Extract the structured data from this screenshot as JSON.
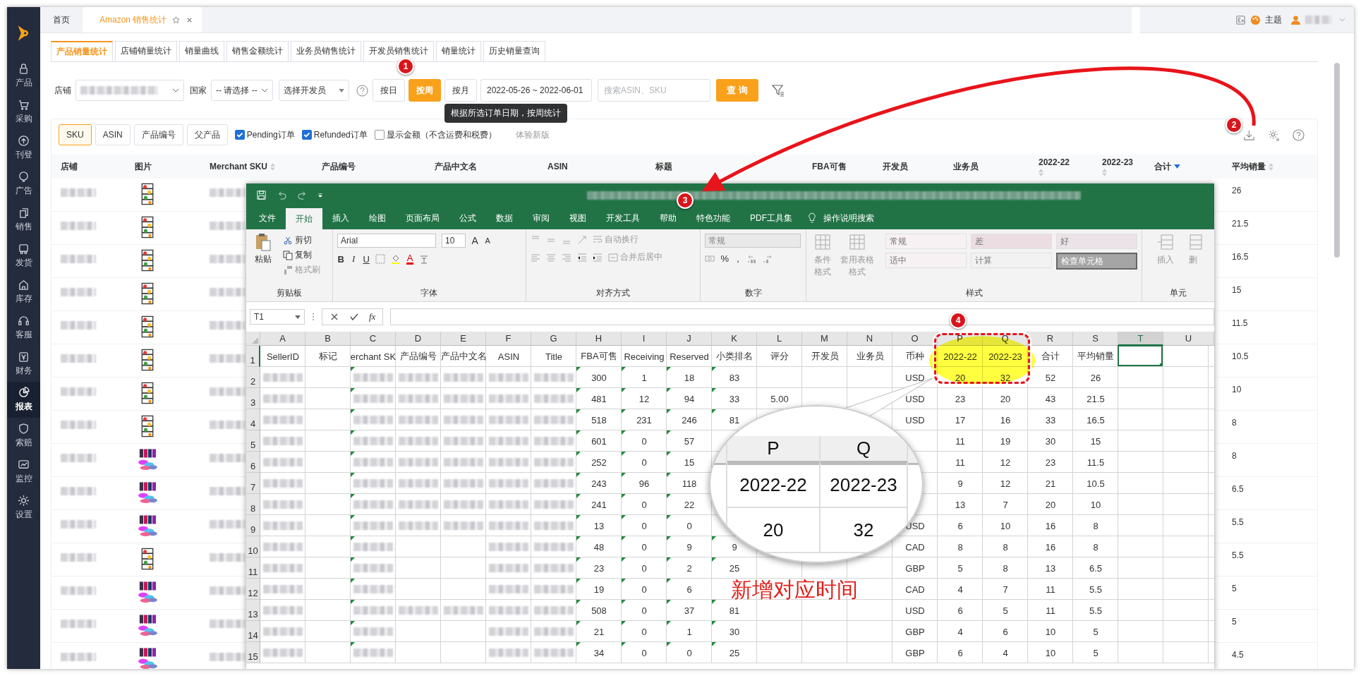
{
  "sidebar": {
    "items": [
      {
        "label": "产品",
        "selected": false
      },
      {
        "label": "采购",
        "selected": false
      },
      {
        "label": "刊登",
        "selected": false
      },
      {
        "label": "广告",
        "selected": false
      },
      {
        "label": "销售",
        "selected": false
      },
      {
        "label": "发货",
        "selected": false
      },
      {
        "label": "库存",
        "selected": false
      },
      {
        "label": "客服",
        "selected": false
      },
      {
        "label": "财务",
        "selected": false
      },
      {
        "label": "报表",
        "selected": true
      },
      {
        "label": "索赔",
        "selected": false
      },
      {
        "label": "监控",
        "selected": false
      },
      {
        "label": "设置",
        "selected": false
      }
    ]
  },
  "top_tabs": [
    {
      "label": "首页",
      "selected": false,
      "closable": false
    },
    {
      "label": "Amazon 销售统计",
      "selected": true,
      "closable": true
    }
  ],
  "header": {
    "theme": "主题"
  },
  "report_tabs": [
    {
      "label": "产品销量统计",
      "selected": true
    },
    {
      "label": "店铺销量统计",
      "selected": false
    },
    {
      "label": "销量曲线",
      "selected": false
    },
    {
      "label": "销售金额统计",
      "selected": false
    },
    {
      "label": "业务员销售统计",
      "selected": false
    },
    {
      "label": "开发员销售统计",
      "selected": false
    },
    {
      "label": "销量统计",
      "selected": false
    },
    {
      "label": "历史销量查询",
      "selected": false
    }
  ],
  "filters": {
    "store_label": "店铺",
    "country_label": "国家",
    "country_value": "-- 请选择 --",
    "developer_placeholder": "选择开发员",
    "periods": [
      {
        "label": "按日",
        "selected": false
      },
      {
        "label": "按周",
        "selected": true
      },
      {
        "label": "按月",
        "selected": false
      }
    ],
    "date_range": "2022-05-26 ~ 2022-06-01",
    "search_placeholder": "搜索ASIN、SKU",
    "query_button": "查 询"
  },
  "tooltip": "根据所选订单日期，按周统计",
  "group_by": [
    {
      "label": "SKU",
      "selected": true
    },
    {
      "label": "ASIN",
      "selected": false
    },
    {
      "label": "产品编号",
      "selected": false
    },
    {
      "label": "父产品",
      "selected": false
    }
  ],
  "options": [
    {
      "label": "Pending订单",
      "checked": true
    },
    {
      "label": "Refunded订单",
      "checked": true
    },
    {
      "label": "显示金额（不含运费和税费）",
      "checked": false
    }
  ],
  "new_version_link": "体验新版",
  "table": {
    "columns": [
      {
        "label": "店铺",
        "kind": "field",
        "sortable": false
      },
      {
        "label": "图片",
        "kind": "field",
        "sortable": false
      },
      {
        "label": "Merchant SKU",
        "kind": "field",
        "sortable": true,
        "sorted_desc": false
      },
      {
        "label": "产品编号",
        "kind": "field",
        "sortable": false
      },
      {
        "label": "产品中文名",
        "kind": "field",
        "sortable": false
      },
      {
        "label": "ASIN",
        "kind": "field",
        "sortable": false
      },
      {
        "label": "标题",
        "kind": "field",
        "sortable": false
      },
      {
        "label": "FBA可售",
        "kind": "field",
        "sortable": false
      },
      {
        "label": "开发员",
        "kind": "field",
        "sortable": false
      },
      {
        "label": "业务员",
        "kind": "field",
        "sortable": false
      },
      {
        "label": "2022-22",
        "kind": "period",
        "sortable": true,
        "sorted_desc": false
      },
      {
        "label": "2022-23",
        "kind": "period",
        "sortable": true,
        "sorted_desc": false
      },
      {
        "label": "合计",
        "kind": "field",
        "sortable": true,
        "sorted_desc": true
      },
      {
        "label": "平均销量",
        "kind": "field",
        "sortable": true,
        "sorted_desc": false
      }
    ],
    "rows": [
      {
        "average_sales": "26"
      },
      {
        "average_sales": "21.5"
      },
      {
        "average_sales": "16.5"
      },
      {
        "average_sales": "15"
      },
      {
        "average_sales": "11.5"
      },
      {
        "average_sales": "10.5"
      },
      {
        "average_sales": "10"
      },
      {
        "average_sales": "8"
      },
      {
        "average_sales": "8"
      },
      {
        "average_sales": "6.5"
      },
      {
        "average_sales": "5.5"
      },
      {
        "average_sales": "5.5"
      },
      {
        "average_sales": "5"
      },
      {
        "average_sales": "5"
      },
      {
        "average_sales": "4.5"
      }
    ]
  },
  "excel": {
    "ribbon_tabs": [
      {
        "label": "文件",
        "selected": false
      },
      {
        "label": "开始",
        "selected": true
      },
      {
        "label": "插入",
        "selected": false
      },
      {
        "label": "绘图",
        "selected": false
      },
      {
        "label": "页面布局",
        "selected": false
      },
      {
        "label": "公式",
        "selected": false
      },
      {
        "label": "数据",
        "selected": false
      },
      {
        "label": "审阅",
        "selected": false
      },
      {
        "label": "视图",
        "selected": false
      },
      {
        "label": "开发工具",
        "selected": false
      },
      {
        "label": "帮助",
        "selected": false
      },
      {
        "label": "特色功能",
        "selected": false
      },
      {
        "label": "PDF工具集",
        "selected": false
      }
    ],
    "tell_me": "操作说明搜索",
    "ribbon": {
      "paste": "粘贴",
      "cut": "剪切",
      "copy": "复制",
      "format_painter": "格式刷",
      "font": "Arial",
      "font_size": "10",
      "size_steps": [
        "A",
        "A"
      ],
      "font_styles": [
        "B",
        "I",
        "U"
      ],
      "font_color": "A",
      "wrap_text": "自动换行",
      "merge_center": "合并后居中",
      "number_format": "常规",
      "percent": "%",
      "comma": ",",
      "conditional_format": "条件格式",
      "table_format": "套用表格格式",
      "cell_styles": [
        {
          "label": "常规",
          "color": "#f7f1f4"
        },
        {
          "label": "差",
          "color": "#ebdde2"
        },
        {
          "label": "好",
          "color": "#ebe3e7"
        },
        {
          "label": "适中",
          "color": "#f7f1f4"
        },
        {
          "label": "计算",
          "color": "#f2f2f2"
        },
        {
          "label": "检查单元格",
          "color": "#a5a5a5"
        }
      ],
      "insert": "插入",
      "delete": "删",
      "groups": [
        "剪贴板",
        "字体",
        "对齐方式",
        "数字",
        "样式",
        "单元"
      ]
    },
    "name_box": "T1",
    "fx": "fx",
    "columns": [
      {
        "letter": "A",
        "selected": false,
        "marked": false
      },
      {
        "letter": "B",
        "selected": false,
        "marked": false
      },
      {
        "letter": "C",
        "selected": false,
        "marked": true
      },
      {
        "letter": "D",
        "selected": false,
        "marked": false
      },
      {
        "letter": "E",
        "selected": false,
        "marked": false
      },
      {
        "letter": "F",
        "selected": false,
        "marked": false
      },
      {
        "letter": "G",
        "selected": false,
        "marked": false
      },
      {
        "letter": "H",
        "selected": false,
        "marked": true
      },
      {
        "letter": "I",
        "selected": false,
        "marked": true
      },
      {
        "letter": "J",
        "selected": false,
        "marked": true
      },
      {
        "letter": "K",
        "selected": false,
        "marked": true
      },
      {
        "letter": "L",
        "selected": false,
        "marked": false
      },
      {
        "letter": "M",
        "selected": false,
        "marked": false
      },
      {
        "letter": "N",
        "selected": false,
        "marked": false
      },
      {
        "letter": "O",
        "selected": false,
        "marked": false
      },
      {
        "letter": "P",
        "selected": false,
        "marked": false
      },
      {
        "letter": "Q",
        "selected": false,
        "marked": false
      },
      {
        "letter": "R",
        "selected": false,
        "marked": false
      },
      {
        "letter": "S",
        "selected": false,
        "marked": false
      },
      {
        "letter": "T",
        "selected": true,
        "marked": false
      },
      {
        "letter": "U",
        "selected": false,
        "marked": false
      }
    ],
    "rows": [
      {
        "number": "1",
        "cells": [
          "SellerID",
          "标记",
          "erchant SK",
          "产品编号",
          "产品中文名",
          "ASIN",
          "Title",
          "FBA可售",
          "Receiving",
          "Reserved",
          "小类排名",
          "评分",
          "开发员",
          "业务员",
          "币种",
          "2022-22",
          "2022-23",
          "合计",
          "平均销量",
          null,
          null
        ]
      },
      {
        "number": "2",
        "cells": [
          {
            "kind": "blurred"
          },
          null,
          {
            "kind": "blurred"
          },
          {
            "kind": "blurred"
          },
          {
            "kind": "blurred"
          },
          {
            "kind": "blurred"
          },
          {
            "kind": "blurred"
          },
          "300",
          "1",
          "18",
          "83",
          null,
          null,
          null,
          "USD",
          "20",
          "32",
          "52",
          "26",
          null,
          null
        ]
      },
      {
        "number": "3",
        "cells": [
          {
            "kind": "blurred"
          },
          null,
          {
            "kind": "blurred"
          },
          {
            "kind": "blurred"
          },
          {
            "kind": "blurred"
          },
          {
            "kind": "blurred"
          },
          {
            "kind": "blurred"
          },
          "481",
          "12",
          "94",
          "33",
          "5.00",
          null,
          null,
          "USD",
          "23",
          "20",
          "43",
          "21.5",
          null,
          null
        ]
      },
      {
        "number": "4",
        "cells": [
          {
            "kind": "blurred"
          },
          null,
          {
            "kind": "blurred"
          },
          {
            "kind": "blurred"
          },
          {
            "kind": "blurred"
          },
          {
            "kind": "blurred"
          },
          {
            "kind": "blurred"
          },
          "518",
          "231",
          "246",
          "81",
          null,
          null,
          null,
          "USD",
          "17",
          "16",
          "33",
          "16.5",
          null,
          null
        ]
      },
      {
        "number": "5",
        "cells": [
          {
            "kind": "blurred"
          },
          null,
          {
            "kind": "blurred"
          },
          {
            "kind": "blurred"
          },
          {
            "kind": "blurred"
          },
          {
            "kind": "blurred"
          },
          {
            "kind": "blurred"
          },
          "601",
          "0",
          "57",
          null,
          null,
          null,
          null,
          null,
          "11",
          "19",
          "30",
          "15",
          null,
          null
        ]
      },
      {
        "number": "6",
        "cells": [
          {
            "kind": "blurred"
          },
          null,
          {
            "kind": "blurred"
          },
          {
            "kind": "blurred"
          },
          {
            "kind": "blurred"
          },
          {
            "kind": "blurred"
          },
          {
            "kind": "blurred"
          },
          "252",
          "0",
          "15",
          null,
          null,
          null,
          null,
          null,
          "11",
          "12",
          "23",
          "11.5",
          null,
          null
        ]
      },
      {
        "number": "7",
        "cells": [
          {
            "kind": "blurred"
          },
          null,
          {
            "kind": "blurred"
          },
          {
            "kind": "blurred"
          },
          {
            "kind": "blurred"
          },
          {
            "kind": "blurred"
          },
          {
            "kind": "blurred"
          },
          "243",
          "96",
          "118",
          null,
          null,
          null,
          null,
          null,
          "9",
          "12",
          "21",
          "10.5",
          null,
          null
        ]
      },
      {
        "number": "8",
        "cells": [
          {
            "kind": "blurred"
          },
          null,
          {
            "kind": "blurred"
          },
          {
            "kind": "blurred"
          },
          {
            "kind": "blurred"
          },
          {
            "kind": "blurred"
          },
          {
            "kind": "blurred"
          },
          "241",
          "0",
          "22",
          null,
          null,
          null,
          null,
          null,
          "13",
          "7",
          "20",
          "10",
          null,
          null
        ]
      },
      {
        "number": "9",
        "cells": [
          {
            "kind": "blurred"
          },
          null,
          {
            "kind": "blurred"
          },
          {
            "kind": "blurred"
          },
          {
            "kind": "blurred"
          },
          {
            "kind": "blurred"
          },
          {
            "kind": "blurred"
          },
          "13",
          "0",
          "0",
          null,
          null,
          null,
          null,
          "USD",
          "6",
          "10",
          "16",
          "8",
          null,
          null
        ]
      },
      {
        "number": "10",
        "cells": [
          {
            "kind": "blurred"
          },
          null,
          {
            "kind": "blurred"
          },
          null,
          null,
          {
            "kind": "blurred"
          },
          {
            "kind": "blurred"
          },
          "48",
          "0",
          "9",
          "9",
          null,
          null,
          null,
          "CAD",
          "8",
          "8",
          "16",
          "8",
          null,
          null
        ]
      },
      {
        "number": "11",
        "cells": [
          {
            "kind": "blurred"
          },
          null,
          {
            "kind": "blurred"
          },
          null,
          null,
          {
            "kind": "blurred"
          },
          {
            "kind": "blurred"
          },
          "23",
          "0",
          "2",
          "25",
          null,
          null,
          null,
          "GBP",
          "5",
          "8",
          "13",
          "6.5",
          null,
          null
        ]
      },
      {
        "number": "12",
        "cells": [
          {
            "kind": "blurred"
          },
          null,
          {
            "kind": "blurred"
          },
          null,
          null,
          {
            "kind": "blurred"
          },
          {
            "kind": "blurred"
          },
          "19",
          "0",
          "6",
          null,
          null,
          null,
          null,
          "CAD",
          "4",
          "7",
          "11",
          "5.5",
          null,
          null
        ]
      },
      {
        "number": "13",
        "cells": [
          {
            "kind": "blurred"
          },
          null,
          {
            "kind": "blurred"
          },
          {
            "kind": "blurred"
          },
          {
            "kind": "blurred"
          },
          {
            "kind": "blurred"
          },
          {
            "kind": "blurred"
          },
          "508",
          "0",
          "37",
          "81",
          null,
          null,
          null,
          "USD",
          "6",
          "5",
          "11",
          "5.5",
          null,
          null
        ]
      },
      {
        "number": "14",
        "cells": [
          {
            "kind": "blurred"
          },
          null,
          {
            "kind": "blurred"
          },
          null,
          null,
          {
            "kind": "blurred"
          },
          {
            "kind": "blurred"
          },
          "21",
          "0",
          "1",
          "30",
          null,
          null,
          null,
          "GBP",
          "4",
          "6",
          "10",
          "5",
          null,
          null
        ]
      },
      {
        "number": "15",
        "cells": [
          {
            "kind": "blurred"
          },
          null,
          {
            "kind": "blurred"
          },
          null,
          null,
          {
            "kind": "blurred"
          },
          {
            "kind": "blurred"
          },
          "34",
          "0",
          "0",
          "25",
          null,
          null,
          null,
          "GBP",
          "6",
          "4",
          "10",
          "5",
          null,
          null
        ]
      }
    ]
  },
  "callout": {
    "columns": [
      "P",
      "Q"
    ],
    "headers": [
      "2022-22",
      "2022-23"
    ],
    "values": [
      "20",
      "32"
    ]
  },
  "annotations": {
    "badges": [
      "1",
      "2",
      "3",
      "4"
    ],
    "note": "新增对应时间"
  }
}
